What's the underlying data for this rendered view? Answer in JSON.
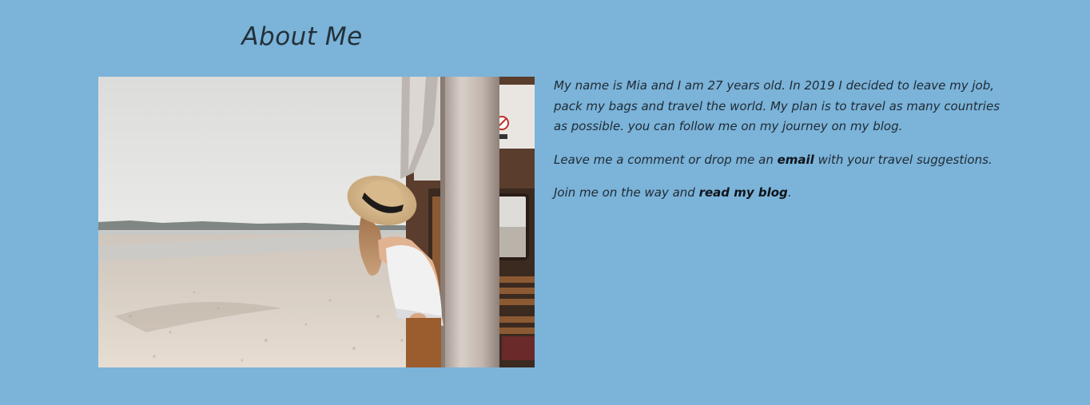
{
  "about": {
    "title": "About Me",
    "image_alt": "Woman in a straw hat leaning out of a train window on a beach",
    "paragraphs": [
      {
        "text": "My name is Mia and I am 27 years old. In 2019 I decided to leave my job, pack my bags and travel the world. My plan is to travel as many countries as possible. you can follow me on my journey on my blog."
      },
      {
        "before": "Leave me a comment or drop me an ",
        "link": "email",
        "after": " with your travel suggestions."
      },
      {
        "before": "Join me on the way and ",
        "link": "read my blog",
        "after": "."
      }
    ]
  },
  "colors": {
    "background": "#7bb3d9",
    "text": "#1f2a33",
    "link": "#0f1419"
  }
}
